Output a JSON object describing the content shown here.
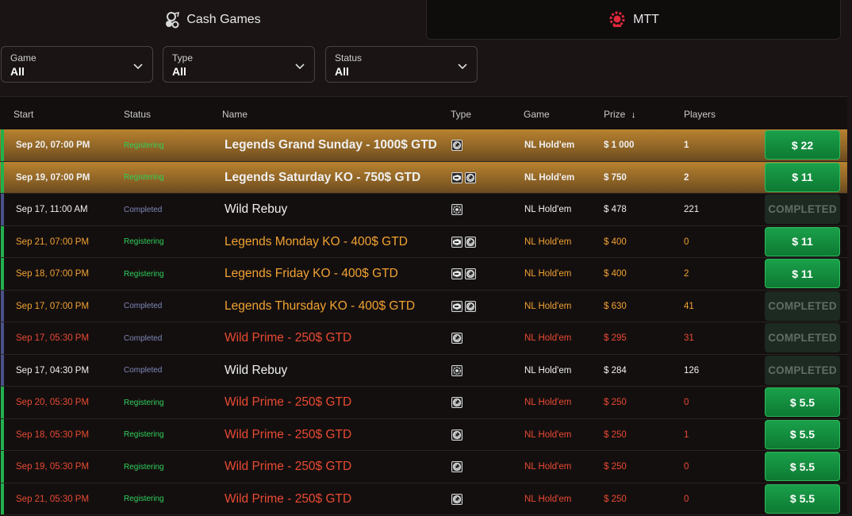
{
  "tabs": {
    "cash": {
      "label": "Cash Games",
      "icon": "cash-games-icon"
    },
    "mtt": {
      "label": "MTT",
      "icon": "mtt-trophy-icon",
      "icon_color": "#e0283a"
    }
  },
  "filters": [
    {
      "label": "Game",
      "value": "All"
    },
    {
      "label": "Type",
      "value": "All"
    },
    {
      "label": "Status",
      "value": "All"
    }
  ],
  "table": {
    "headers": {
      "start": "Start",
      "status": "Status",
      "name": "Name",
      "type": "Type",
      "game": "Game",
      "prize": "Prize",
      "prize_sort": "↓",
      "players": "Players"
    },
    "colors": {
      "registering_status": "#2fd05a",
      "completed_status": "#7c88b8",
      "legends": "#f0a232",
      "prime": "#e84a32",
      "white": "#f0f0f0",
      "green_bar": "#22b14c",
      "blue_bar": "#4a5288"
    },
    "rows": [
      {
        "start": "Sep 20, 07:00 PM",
        "status": "Registering",
        "name": "Legends Grand Sunday - 1000$ GTD",
        "type_icons": [
          "freezeout-icon"
        ],
        "game": "NL Hold'em",
        "prize": "$ 1 000",
        "players": "1",
        "action": "$ 22",
        "action_kind": "buy",
        "style": "highlight"
      },
      {
        "start": "Sep 19, 07:00 PM",
        "status": "Registering",
        "name": "Legends Saturday KO - 750$ GTD",
        "type_icons": [
          "knockout-icon",
          "freezeout-icon"
        ],
        "game": "NL Hold'em",
        "prize": "$ 750",
        "players": "2",
        "action": "$ 11",
        "action_kind": "buy",
        "style": "highlight"
      },
      {
        "start": "Sep 17, 11:00 AM",
        "status": "Completed",
        "name": "Wild Rebuy",
        "type_icons": [
          "rebuy-icon"
        ],
        "game": "NL Hold'em",
        "prize": "$ 478",
        "players": "221",
        "action": "COMPLETED",
        "action_kind": "done",
        "style": "white"
      },
      {
        "start": "Sep 21, 07:00 PM",
        "status": "Registering",
        "name": "Legends Monday KO - 400$ GTD",
        "type_icons": [
          "knockout-icon",
          "freezeout-icon"
        ],
        "game": "NL Hold'em",
        "prize": "$ 400",
        "players": "0",
        "action": "$ 11",
        "action_kind": "buy",
        "style": "legends"
      },
      {
        "start": "Sep 18, 07:00 PM",
        "status": "Registering",
        "name": "Legends Friday KO - 400$ GTD",
        "type_icons": [
          "knockout-icon",
          "freezeout-icon"
        ],
        "game": "NL Hold'em",
        "prize": "$ 400",
        "players": "2",
        "action": "$ 11",
        "action_kind": "buy",
        "style": "legends"
      },
      {
        "start": "Sep 17, 07:00 PM",
        "status": "Completed",
        "name": "Legends Thursday KO - 400$ GTD",
        "type_icons": [
          "knockout-icon",
          "freezeout-icon"
        ],
        "game": "NL Hold'em",
        "prize": "$ 630",
        "players": "41",
        "action": "COMPLETED",
        "action_kind": "done",
        "style": "legends"
      },
      {
        "start": "Sep 17, 05:30 PM",
        "status": "Completed",
        "name": "Wild Prime - 250$ GTD",
        "type_icons": [
          "freezeout-icon"
        ],
        "game": "NL Hold'em",
        "prize": "$ 295",
        "players": "31",
        "action": "COMPLETED",
        "action_kind": "done",
        "style": "prime"
      },
      {
        "start": "Sep 17, 04:30 PM",
        "status": "Completed",
        "name": "Wild Rebuy",
        "type_icons": [
          "rebuy-icon"
        ],
        "game": "NL Hold'em",
        "prize": "$ 284",
        "players": "126",
        "action": "COMPLETED",
        "action_kind": "done",
        "style": "white"
      },
      {
        "start": "Sep 20, 05:30 PM",
        "status": "Registering",
        "name": "Wild Prime - 250$ GTD",
        "type_icons": [
          "freezeout-icon"
        ],
        "game": "NL Hold'em",
        "prize": "$ 250",
        "players": "0",
        "action": "$ 5.5",
        "action_kind": "buy",
        "style": "prime"
      },
      {
        "start": "Sep 18, 05:30 PM",
        "status": "Registering",
        "name": "Wild Prime - 250$ GTD",
        "type_icons": [
          "freezeout-icon"
        ],
        "game": "NL Hold'em",
        "prize": "$ 250",
        "players": "1",
        "action": "$ 5.5",
        "action_kind": "buy",
        "style": "prime"
      },
      {
        "start": "Sep 19, 05:30 PM",
        "status": "Registering",
        "name": "Wild Prime - 250$ GTD",
        "type_icons": [
          "freezeout-icon"
        ],
        "game": "NL Hold'em",
        "prize": "$ 250",
        "players": "0",
        "action": "$ 5.5",
        "action_kind": "buy",
        "style": "prime"
      },
      {
        "start": "Sep 21, 05:30 PM",
        "status": "Registering",
        "name": "Wild Prime - 250$ GTD",
        "type_icons": [
          "freezeout-icon"
        ],
        "game": "NL Hold'em",
        "prize": "$ 250",
        "players": "0",
        "action": "$ 5.5",
        "action_kind": "buy",
        "style": "prime"
      }
    ]
  }
}
